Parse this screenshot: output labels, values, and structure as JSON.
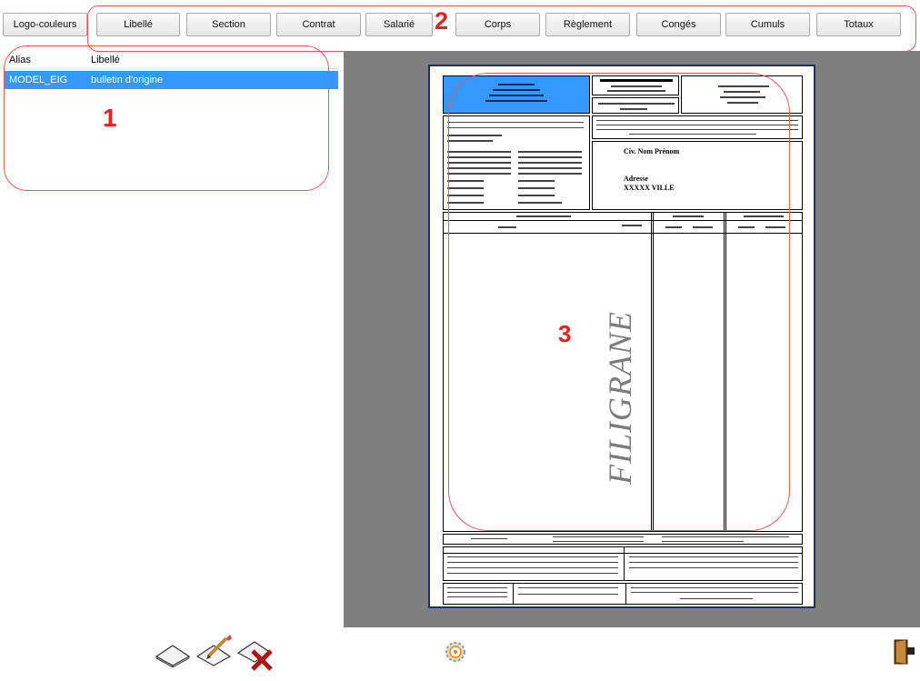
{
  "toolbar": {
    "buttons": [
      "Logo-couleurs",
      "Libellé",
      "Section",
      "Contrat",
      "Salarié",
      "Corps",
      "Règlement",
      "Congés",
      "Cumuls",
      "Totaux"
    ]
  },
  "annotations": {
    "one": "1",
    "two": "2",
    "three": "3"
  },
  "grid": {
    "columns": [
      "Alias",
      "Libellé"
    ],
    "rows": [
      {
        "alias": "MODEL_EIG",
        "libelle": "bulletin d'origine"
      }
    ]
  },
  "preview": {
    "watermark": "FILIGRANE",
    "recipient_name": "Civ. Nom Prénom",
    "recipient_address": "Adresse",
    "recipient_city": "XXXXX VILLE"
  },
  "colors": {
    "selection": "#3399ff",
    "annotation": "#e82020",
    "preview_bg": "#7f7f7f",
    "logo_box": "#3399ff"
  },
  "icons": [
    "new-document-icon",
    "edit-document-icon",
    "delete-document-icon",
    "settings-gear-icon",
    "exit-door-icon"
  ]
}
